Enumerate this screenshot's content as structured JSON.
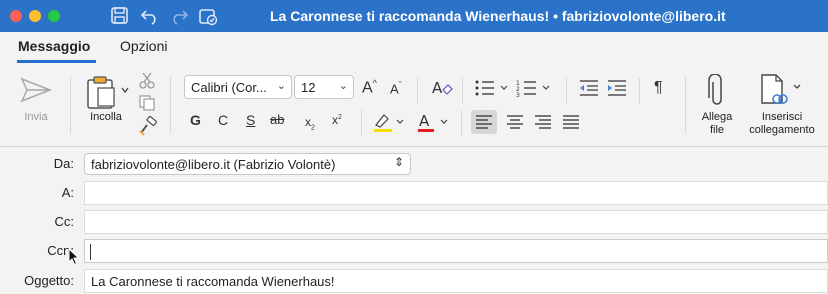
{
  "window": {
    "title": "La Caronnese ti raccomanda Wienerhaus! • fabriziovolonte@libero.it"
  },
  "tabs": [
    {
      "label": "Messaggio",
      "active": true
    },
    {
      "label": "Opzioni",
      "active": false
    }
  ],
  "ribbon": {
    "send_label": "Invia",
    "paste_label": "Incolla",
    "font_name": "Calibri (Cor...",
    "font_size": "12",
    "grow_font": "A",
    "shrink_font": "A",
    "bold": "G",
    "italic": "C",
    "underline": "S",
    "strikethrough": "ab",
    "subscript": "x",
    "superscript": "x",
    "font_color_letter": "A",
    "highlight_color": "#f2e100",
    "font_color": "#e02020",
    "paragraph_mark": "¶",
    "attach_label_line1": "Allega",
    "attach_label_line2": "file",
    "link_label_line1": "Inserisci",
    "link_label_line2": "collegamento"
  },
  "fields": {
    "from_label": "Da:",
    "from_value": "fabriziovolonte@libero.it (Fabrizio Volontè)",
    "to_label": "A:",
    "to_value": "",
    "cc_label": "Cc:",
    "cc_value": "",
    "bcc_label": "Ccn:",
    "bcc_value": "",
    "subject_label": "Oggetto:",
    "subject_value": "La Caronnese ti raccomanda Wienerhaus!"
  },
  "colors": {
    "titlebar": "#2b72c9",
    "accent": "#1f6fcf"
  }
}
